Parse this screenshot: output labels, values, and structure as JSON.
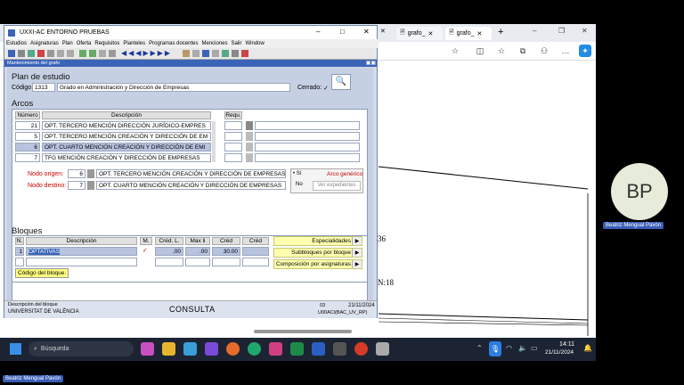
{
  "browser": {
    "tabs": [
      "grafo_",
      "grafo_"
    ],
    "new_tab": "+",
    "page_snippets": [
      "36",
      "N:18"
    ]
  },
  "participant": {
    "initials": "BP",
    "name": "Beatriz Mengual Pavón"
  },
  "app": {
    "title": "UXXI-AC ENTORNO PRUEBAS",
    "window_controls": [
      "–",
      "□",
      "✕"
    ],
    "menu": [
      "Estudios",
      "Asignaturas",
      "Plan",
      "Oferta",
      "Requisitos",
      "Planteles",
      "Programas docentes",
      "Menciones",
      "Salir",
      "Window"
    ],
    "subtitle": "Mantenimiento del grafo",
    "plan": {
      "heading": "Plan de estudio",
      "code_label": "Código",
      "code": "1313",
      "name": "Grado en Administración y Dirección de Empresas",
      "closed_label": "Cerrado:",
      "closed_mark": "✓"
    },
    "arcos": {
      "heading": "Arcos",
      "col_numero": "Número",
      "col_descripcion": "Descripción",
      "col_requ": "Requ.",
      "rows": [
        {
          "num": "21",
          "desc": "OPT. TERCERO MENCIÓN DIRECCIÓN JURÍDICO-EMPRES"
        },
        {
          "num": "5",
          "desc": "OPT. TERCERO MENCIÓN CREACIÓN Y DIRECCIÓN DE EM"
        },
        {
          "num": "6",
          "desc": "OPT. CUARTO MENCIÓN CREACIÓN Y DIRECCIÓN DE EMI"
        },
        {
          "num": "7",
          "desc": "TFG MENCIÓN CREACIÓN Y DIRECCIÓN DE EMPRESAS"
        }
      ],
      "origin_label": "Nodo origen:",
      "origin_num": "6",
      "origin_desc": "OPT. TERCERO MENCIÓN CREACIÓN Y DIRECCIÓN DE EMPRESAS",
      "dest_label": "Nodo destino:",
      "dest_num": "7",
      "dest_desc": "OPT. CUARTO MENCIÓN CREACIÓN Y DIRECCIÓN DE EMPRESAS",
      "si_label": "Sí",
      "no_label": "No",
      "generic_label": "Arco genérico",
      "ver_exp": "Ver expedientes"
    },
    "bloques": {
      "heading": "Bloques",
      "cols": [
        "N.",
        "Descripción",
        "M.",
        "Créd. L.",
        "Max li",
        "Créd",
        "Créd"
      ],
      "row": {
        "n": "1",
        "desc": "OPTATIVAS",
        "m": "✓",
        "cred_l": ".00",
        "max_li": ".00",
        "cred": "30.00"
      },
      "tooltip": "Código del bloque.",
      "buttons": [
        "Especialidades",
        "Subbloques por bloque",
        "Composición por asignaturas"
      ]
    },
    "status": {
      "hint_label": "Descripción del bloque",
      "org": "UNIVERSITAT DE VALÈNCIA",
      "mode": "CONSULTA",
      "code": "03",
      "date": "21/11/2024",
      "user": "U00ACl(BAC_UV_RP)"
    }
  },
  "taskbar": {
    "search_placeholder": "Búsqueda",
    "time": "14:11",
    "date": "21/11/2024"
  },
  "bottom_name": "Beatriz Mengual Pavón"
}
